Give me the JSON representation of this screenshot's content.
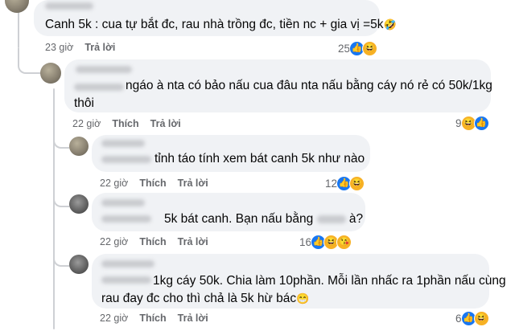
{
  "comments": [
    {
      "text": "Canh 5k : cua tự bắt đc, rau nhà trồng đc, tiền nc + gia vị =5k",
      "emoji": "🤣",
      "time": "23 giờ",
      "reply_label": "Trả lời",
      "reaction_count": "25",
      "reactions": [
        "like-icon",
        "haha-icon"
      ]
    },
    {
      "line1": "ngáo à nta có bảo nấu cua đâu nta nấu bằng cáy nó rẻ có 50k/1kg",
      "line2": "thôi",
      "time": "22 giờ",
      "like_label": "Thích",
      "reply_label": "Trả lời",
      "reaction_count": "9",
      "reactions": [
        "haha-icon",
        "like-icon"
      ]
    },
    {
      "text": "tỉnh táo tính xem bát canh 5k như nào",
      "time": "22 giờ",
      "like_label": "Thích",
      "reply_label": "Trả lời",
      "reaction_count": "12",
      "reactions": [
        "like-icon",
        "haha-icon"
      ]
    },
    {
      "text_before": "5k bát canh. Bạn nấu bằng",
      "text_after": "à?",
      "time": "22 giờ",
      "like_label": "Thích",
      "reply_label": "Trả lời",
      "reaction_count": "16",
      "reactions": [
        "like-icon",
        "haha-icon",
        "love-icon"
      ]
    },
    {
      "line1": "1kg cáy 50k. Chia làm 10phần. Mỗi lần nhấc ra 1phần nấu cùng",
      "line2": "rau đay đc cho thì chả là 5k hừ bác",
      "emoji": "😁",
      "time": "22 giờ",
      "like_label": "Thích",
      "reply_label": "Trả lời",
      "reaction_count": "6",
      "reactions": [
        "like-icon",
        "haha-icon"
      ]
    }
  ],
  "colors": {
    "bubble": "#f0f2f5",
    "meta": "#65676b",
    "like": "#1877f2",
    "haha": "#f7b125"
  }
}
